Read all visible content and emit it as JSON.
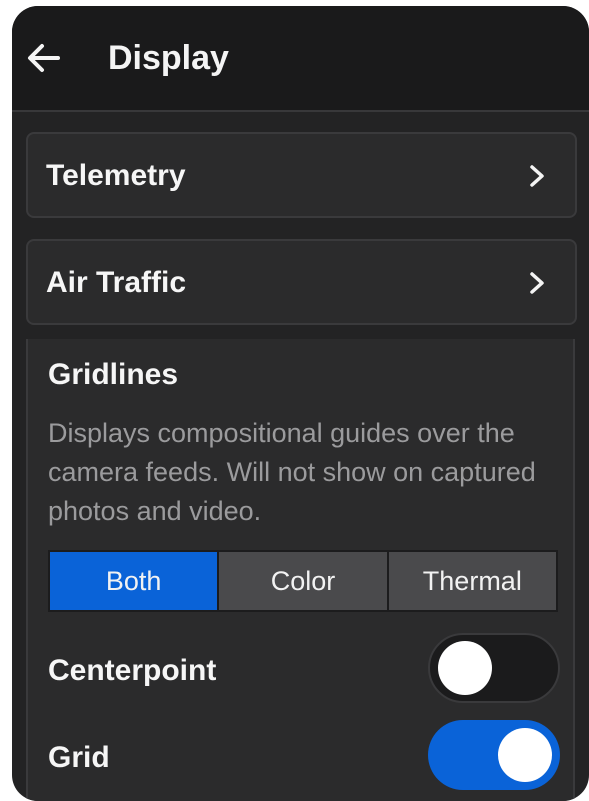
{
  "header": {
    "title": "Display",
    "back_icon": "arrow-left-icon"
  },
  "nav_rows": [
    {
      "label": "Telemetry",
      "icon": "chevron-right-icon"
    },
    {
      "label": "Air Traffic",
      "icon": "chevron-right-icon"
    }
  ],
  "gridlines": {
    "title": "Gridlines",
    "description": "Displays compositional guides over the camera feeds. Will not show on captured photos and video.",
    "options": [
      "Both",
      "Color",
      "Thermal"
    ],
    "selected": "Both"
  },
  "toggles": {
    "centerpoint": {
      "label": "Centerpoint",
      "state": "off"
    },
    "grid": {
      "label": "Grid",
      "state": "on"
    }
  },
  "colors": {
    "accent": "#0a63d8",
    "background": "#232324",
    "header": "#1a1a1b"
  }
}
